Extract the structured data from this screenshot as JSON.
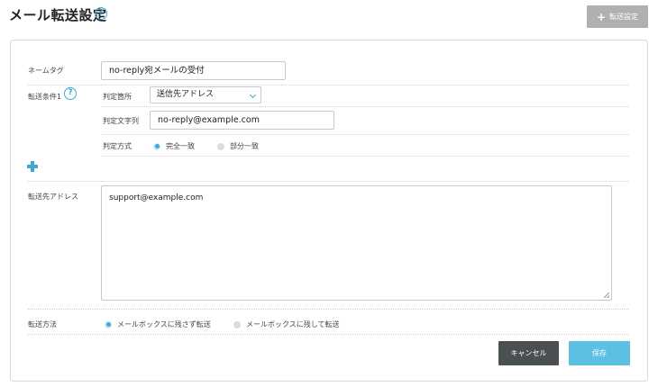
{
  "header": {
    "title": "メール転送設定",
    "help_icon": "?",
    "add_button_label": "転送設定",
    "add_button_icon": "+"
  },
  "form": {
    "name_tag": {
      "label": "ネームタグ",
      "value": "no-reply宛メールの受付"
    },
    "condition": {
      "label": "転送条件1",
      "help_icon": "?",
      "target_label": "判定箇所",
      "target_value": "送信先アドレス",
      "match_text_label": "判定文字列",
      "match_text_value": "no-reply@example.com",
      "match_mode_label": "判定方式",
      "match_mode_options": [
        "完全一致",
        "部分一致"
      ],
      "match_mode_selected": "完全一致"
    },
    "add_condition_icon": "plus-icon",
    "forward_address": {
      "label": "転送先アドレス",
      "value": "support@example.com"
    },
    "forward_method": {
      "label": "転送方法",
      "options": [
        "メールボックスに残さず転送",
        "メールボックスに残して転送"
      ],
      "selected": "メールボックスに残さず転送"
    }
  },
  "actions": {
    "cancel_label": "キャンセル",
    "save_label": "保存"
  },
  "colors": {
    "accent": "#3fa9d4",
    "save_button": "#5cc0e2",
    "cancel_button": "#4a5052",
    "add_button": "#b0b0b0"
  }
}
